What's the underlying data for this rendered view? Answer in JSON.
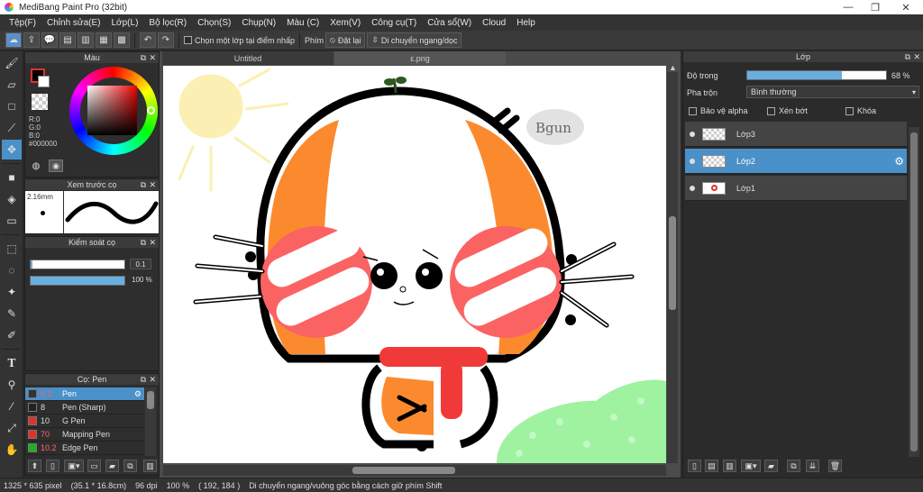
{
  "window": {
    "title": "MediBang Paint Pro (32bit)",
    "minimize": "—",
    "restore": "❐",
    "close": "✕"
  },
  "menu": [
    "Tệp(F)",
    "Chỉnh sửa(E)",
    "Lớp(L)",
    "Bộ lọc(R)",
    "Chọn(S)",
    "Chụp(N)",
    "Màu (C)",
    "Xem(V)",
    "Công cụ(T)",
    "Cửa sổ(W)",
    "Cloud",
    "Help"
  ],
  "toolbar": {
    "select_layer_label": "Chọn một lớp tại điểm nhấp",
    "key_label": "Phím",
    "reset_label": "Đặt lại",
    "move_label": "Di chuyển ngang/dọc"
  },
  "color_panel": {
    "title": "Màu",
    "r": "R:0",
    "g": "G:0",
    "b": "B:0",
    "hex": "#000000",
    "primary": "#000000",
    "secondary": "#ffffff"
  },
  "brush_preview": {
    "title": "Xem trước cọ",
    "size": "2.16mm"
  },
  "brush_control": {
    "title": "Kiểm soát cọ",
    "size_value": "0.1",
    "opacity_value": "100 %",
    "size_fraction": 0.02,
    "opacity_fraction": 1.0
  },
  "brush_list": {
    "title": "Cọ: Pen",
    "items": [
      {
        "size": "0.1",
        "name": "Pen",
        "color": "#333333",
        "selected": true
      },
      {
        "size": "8",
        "name": "Pen (Sharp)",
        "color": "#222222",
        "selected": false
      },
      {
        "size": "10",
        "name": "G Pen",
        "color": "#e03030",
        "selected": false
      },
      {
        "size": "70",
        "name": "Mapping Pen",
        "color": "#e03030",
        "selected": false
      },
      {
        "size": "10.2",
        "name": "Edge Pen",
        "color": "#20b020",
        "selected": false
      }
    ]
  },
  "tabs": [
    {
      "label": "Untitled",
      "active": false
    },
    {
      "label": "ε.png",
      "active": true
    }
  ],
  "drawing": {
    "signature": "Bgun"
  },
  "layers_panel": {
    "title": "Lớp",
    "opacity_label": "Độ trong",
    "opacity_value": "68 %",
    "opacity_fraction": 0.68,
    "blend_label": "Pha trộn",
    "blend_value": "Bình thường",
    "protect_alpha": "Bảo vệ alpha",
    "clipping": "Xén bớt",
    "lock": "Khóa",
    "layers": [
      {
        "name": "Lớp3",
        "selected": false
      },
      {
        "name": "Lớp2",
        "selected": true
      },
      {
        "name": "Lớp1",
        "selected": false
      }
    ]
  },
  "status": {
    "size": "1325 * 635 pixel",
    "cm": "(35.1 * 16.8cm)",
    "dpi": "96 dpi",
    "zoom": "100 %",
    "coords": "( 192, 184 )",
    "hint": "Di chuyển ngang/vuông góc bằng cách giữ phím Shift"
  }
}
